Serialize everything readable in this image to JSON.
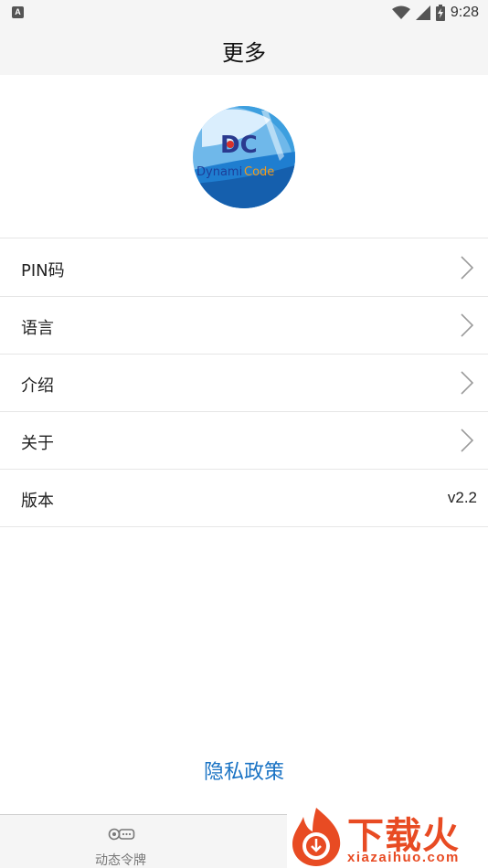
{
  "status_bar": {
    "notification_glyph": "A",
    "time": "9:28",
    "icons": [
      "notification-icon",
      "wifi-icon",
      "signal-icon",
      "battery-charging-icon"
    ]
  },
  "header": {
    "title": "更多"
  },
  "logo": {
    "text_primary": "Dynami",
    "text_accent": "Code",
    "monogram": "DC"
  },
  "menu": {
    "items": [
      {
        "label": "PIN码"
      },
      {
        "label": "语言"
      },
      {
        "label": "介绍"
      },
      {
        "label": "关于"
      },
      {
        "label": "版本",
        "value": "v2.2"
      }
    ]
  },
  "privacy_link": "隐私政策",
  "tab_bar": {
    "tabs": [
      {
        "label": "动态令牌",
        "icon": "key-icon"
      },
      {
        "label": "",
        "icon": "more-icon"
      }
    ]
  },
  "watermark": {
    "brand": "下载火",
    "url": "xiazaihuo.com"
  },
  "colors": {
    "accent": "#1a73c4",
    "header_bg": "#f5f5f5",
    "watermark": "#e84b23"
  }
}
